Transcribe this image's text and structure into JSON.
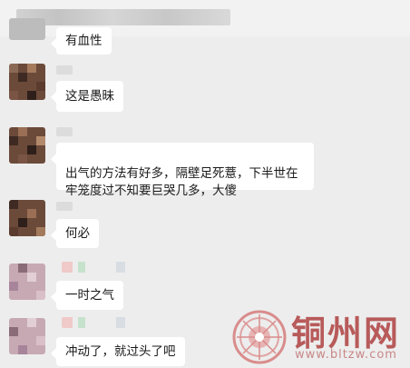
{
  "conversation": {
    "messages": [
      {
        "text": "有血性"
      },
      {
        "text": "这是愚昧"
      },
      {
        "text": "出气的方法有好多，隔壁足死薏，下半世在\n牢笼度过不知要巨哭几多，大傻"
      },
      {
        "text": "何必"
      },
      {
        "text": "一时之气"
      },
      {
        "text": "冲动了，就过头了吧"
      }
    ]
  },
  "watermark": {
    "title": "铜州网",
    "url": "www.bltzw.com"
  },
  "colors": {
    "background": "#ededed",
    "bubble": "#ffffff",
    "watermark": "#b85a5a"
  }
}
